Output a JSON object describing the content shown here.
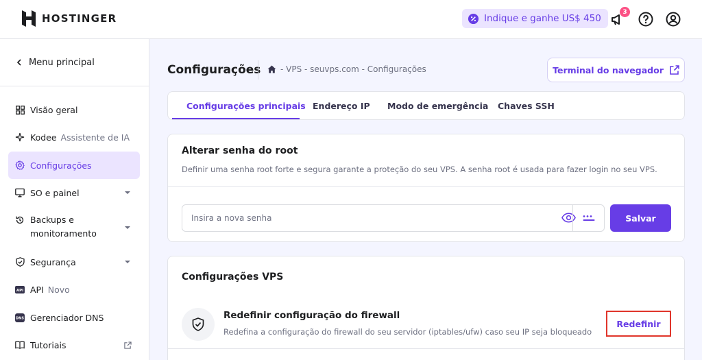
{
  "header": {
    "brand": "HOSTINGER",
    "promo_label": "Indique e ganhe US$ 450",
    "notification_count": "3",
    "colors": {
      "accent": "#673de6",
      "promo_bg": "#ebe4ff",
      "badge": "#fc5185"
    }
  },
  "sidebar": {
    "back_label": "Menu principal",
    "items": [
      {
        "label": "Visão geral",
        "icon": "grid-icon"
      },
      {
        "label": "Kodee",
        "extra": "Assistente de IA",
        "icon": "sparkle-icon"
      },
      {
        "label": "Configurações",
        "icon": "gear-icon",
        "active": true
      },
      {
        "label": "SO e painel",
        "icon": "monitor-icon",
        "expandable": true
      },
      {
        "label": "Backups e monitoramento",
        "icon": "backup-icon",
        "expandable": true
      },
      {
        "label": "Segurança",
        "icon": "shield-icon",
        "expandable": true
      },
      {
        "label": "API",
        "extra": "Novo",
        "icon": "api-icon"
      },
      {
        "label": "Gerenciador DNS",
        "icon": "dns-icon"
      },
      {
        "label": "Tutoriais",
        "icon": "book-icon",
        "external": true
      }
    ]
  },
  "main": {
    "title": "Configurações",
    "breadcrumb": "- VPS - seuvps.com - Configurações",
    "terminal_button": "Terminal do navegador",
    "tabs": [
      {
        "label": "Configurações principais",
        "active": true
      },
      {
        "label": "Endereço IP"
      },
      {
        "label": "Modo de emergência"
      },
      {
        "label": "Chaves SSH"
      }
    ],
    "root_password": {
      "title": "Alterar senha do root",
      "description": "Definir uma senha root forte e segura garante a proteção do seu VPS. A senha root é usada para fazer login no seu VPS.",
      "placeholder": "Insira a nova senha",
      "save_label": "Salvar"
    },
    "vps_settings": {
      "title": "Configurações VPS",
      "firewall_title": "Redefinir configuração do firewall",
      "firewall_description": "Redefina a configuração do firewall do seu servidor (iptables/ufw) caso seu IP seja bloqueado",
      "reset_label": "Redefinir"
    }
  }
}
